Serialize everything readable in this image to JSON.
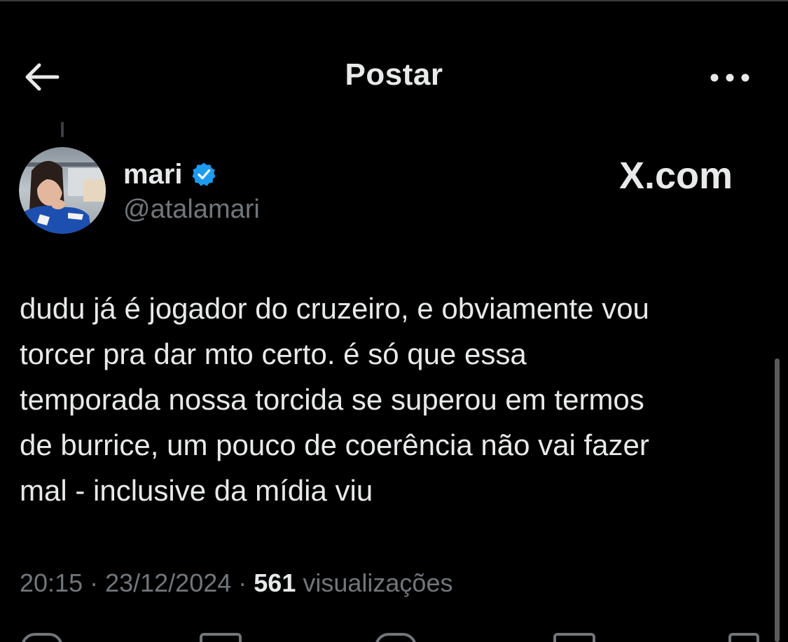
{
  "header": {
    "title": "Postar"
  },
  "tweet": {
    "display_name": "mari",
    "handle": "@atalamari",
    "verified": true,
    "watermark": "X.com",
    "text": "dudu já é jogador do cruzeiro, e obviamente vou\ntorcer pra dar mto certo. é só que essa\ntemporada nossa torcida se superou em termos\nde burrice, um pouco de coerência não vai fazer\nmal - inclusive da mídia viu",
    "time": "20:15",
    "separator": " · ",
    "date": "23/12/2024",
    "views_count": "561",
    "views_label": "visualizações"
  },
  "colors": {
    "background": "#000000",
    "text_primary": "#e7e9ea",
    "text_secondary": "#71767b",
    "verified_badge": "#1d9bf0"
  },
  "icons": {
    "back": "arrow-left-icon",
    "more": "more-horizontal-icon",
    "verified": "verified-badge-icon",
    "x_logo": "x-logo-icon"
  }
}
